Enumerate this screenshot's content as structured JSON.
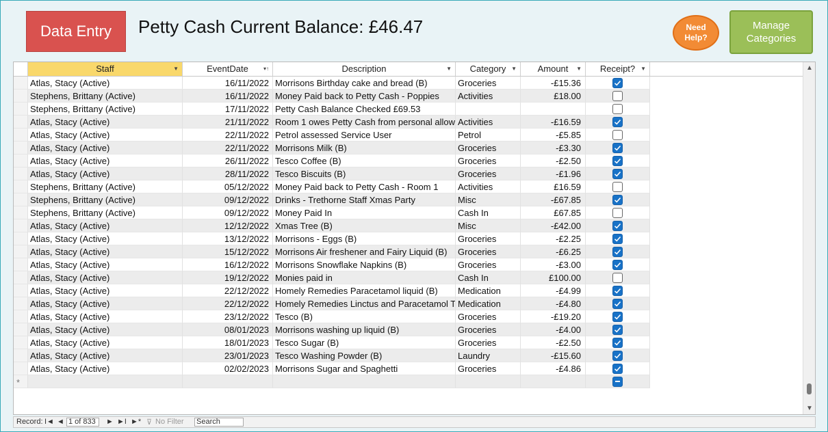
{
  "header": {
    "data_entry_label": "Data Entry",
    "title": "Petty Cash Current Balance: £46.47",
    "help_line1": "Need",
    "help_line2": "Help?",
    "manage_line1": "Manage",
    "manage_line2": "Categories"
  },
  "colors": {
    "data_entry_bg": "#d9524f",
    "help_bg": "#f28b35",
    "manage_bg": "#9bbf58",
    "checkbox_checked": "#1872c7"
  },
  "columns": [
    "Staff",
    "EventDate",
    "Description",
    "Category",
    "Amount",
    "Receipt?"
  ],
  "rows": [
    {
      "staff": "Atlas, Stacy (Active)",
      "date": "16/11/2022",
      "desc": "Morrisons Birthday cake and bread (B)",
      "cat": "Groceries",
      "amt": "-£15.36",
      "receipt": true
    },
    {
      "staff": "Stephens, Brittany (Active)",
      "date": "16/11/2022",
      "desc": "Money Paid back to Petty Cash - Poppies",
      "cat": "Activities",
      "amt": "£18.00",
      "receipt": false
    },
    {
      "staff": "Stephens, Brittany (Active)",
      "date": "17/11/2022",
      "desc": "Petty Cash Balance Checked £69.53",
      "cat": "",
      "amt": "",
      "receipt": false
    },
    {
      "staff": "Atlas, Stacy (Active)",
      "date": "21/11/2022",
      "desc": "Room 1 owes Petty Cash from personal allow",
      "cat": "Activities",
      "amt": "-£16.59",
      "receipt": true
    },
    {
      "staff": "Atlas, Stacy (Active)",
      "date": "22/11/2022",
      "desc": "Petrol assessed Service User",
      "cat": "Petrol",
      "amt": "-£5.85",
      "receipt": false
    },
    {
      "staff": "Atlas, Stacy (Active)",
      "date": "22/11/2022",
      "desc": "Morrisons Milk (B)",
      "cat": "Groceries",
      "amt": "-£3.30",
      "receipt": true
    },
    {
      "staff": "Atlas, Stacy (Active)",
      "date": "26/11/2022",
      "desc": "Tesco Coffee (B)",
      "cat": "Groceries",
      "amt": "-£2.50",
      "receipt": true
    },
    {
      "staff": "Atlas, Stacy (Active)",
      "date": "28/11/2022",
      "desc": "Tesco Biscuits (B)",
      "cat": "Groceries",
      "amt": "-£1.96",
      "receipt": true
    },
    {
      "staff": "Stephens, Brittany (Active)",
      "date": "05/12/2022",
      "desc": "Money Paid back to Petty Cash - Room 1",
      "cat": "Activities",
      "amt": "£16.59",
      "receipt": false
    },
    {
      "staff": "Stephens, Brittany (Active)",
      "date": "09/12/2022",
      "desc": "Drinks - Trethorne Staff Xmas Party",
      "cat": "Misc",
      "amt": "-£67.85",
      "receipt": true
    },
    {
      "staff": "Stephens, Brittany (Active)",
      "date": "09/12/2022",
      "desc": "Money Paid In",
      "cat": "Cash In",
      "amt": "£67.85",
      "receipt": false
    },
    {
      "staff": "Atlas, Stacy (Active)",
      "date": "12/12/2022",
      "desc": "Xmas Tree (B)",
      "cat": "Misc",
      "amt": "-£42.00",
      "receipt": true
    },
    {
      "staff": "Atlas, Stacy (Active)",
      "date": "13/12/2022",
      "desc": "Morrisons - Eggs (B)",
      "cat": "Groceries",
      "amt": "-£2.25",
      "receipt": true
    },
    {
      "staff": "Atlas, Stacy (Active)",
      "date": "15/12/2022",
      "desc": "Morrisons Air freshener and Fairy Liquid (B)",
      "cat": "Groceries",
      "amt": "-£6.25",
      "receipt": true
    },
    {
      "staff": "Atlas, Stacy (Active)",
      "date": "16/12/2022",
      "desc": "Morrisons Snowflake Napkins (B)",
      "cat": "Groceries",
      "amt": "-£3.00",
      "receipt": true
    },
    {
      "staff": "Atlas, Stacy (Active)",
      "date": "19/12/2022",
      "desc": "Monies paid in",
      "cat": "Cash In",
      "amt": "£100.00",
      "receipt": false
    },
    {
      "staff": "Atlas, Stacy (Active)",
      "date": "22/12/2022",
      "desc": "Homely Remedies Paracetamol liquid (B)",
      "cat": "Medication",
      "amt": "-£4.99",
      "receipt": true
    },
    {
      "staff": "Atlas, Stacy (Active)",
      "date": "22/12/2022",
      "desc": "Homely Remedies Linctus and Paracetamol T",
      "cat": "Medication",
      "amt": "-£4.80",
      "receipt": true
    },
    {
      "staff": "Atlas, Stacy (Active)",
      "date": "23/12/2022",
      "desc": "Tesco (B)",
      "cat": "Groceries",
      "amt": "-£19.20",
      "receipt": true
    },
    {
      "staff": "Atlas, Stacy (Active)",
      "date": "08/01/2023",
      "desc": "Morrisons washing up liquid (B)",
      "cat": "Groceries",
      "amt": "-£4.00",
      "receipt": true
    },
    {
      "staff": "Atlas, Stacy (Active)",
      "date": "18/01/2023",
      "desc": "Tesco Sugar (B)",
      "cat": "Groceries",
      "amt": "-£2.50",
      "receipt": true
    },
    {
      "staff": "Atlas, Stacy (Active)",
      "date": "23/01/2023",
      "desc": "Tesco Washing Powder (B)",
      "cat": "Laundry",
      "amt": "-£15.60",
      "receipt": true
    },
    {
      "staff": "Atlas, Stacy (Active)",
      "date": "02/02/2023",
      "desc": "Morrisons Sugar and Spaghetti",
      "cat": "Groceries",
      "amt": "-£4.86",
      "receipt": true
    }
  ],
  "new_row_marker": "*",
  "nav": {
    "record_label": "Record:",
    "first": "I◄",
    "prev": "◄",
    "current": "1 of 833",
    "next": "►",
    "last": "►I",
    "new": "►*",
    "no_filter": "No Filter",
    "search_placeholder": "Search"
  }
}
